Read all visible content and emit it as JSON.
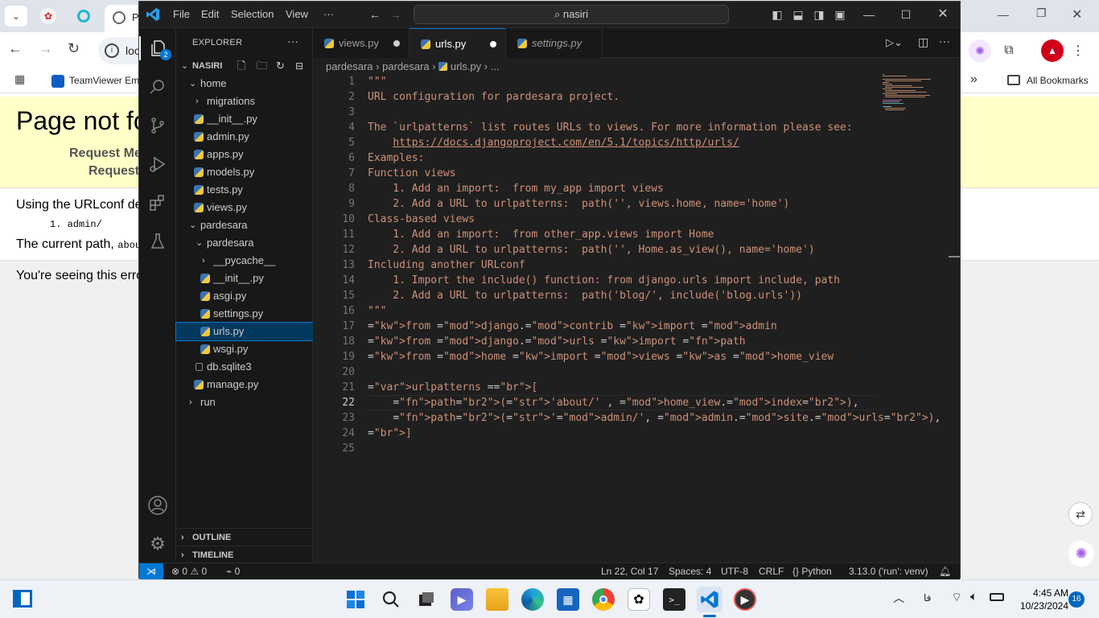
{
  "browser": {
    "address_partial": "loc",
    "bookmark_partial": "TeamViewer Em",
    "all_bookmarks": "All Bookmarks",
    "tab_partial": "P"
  },
  "django_page": {
    "title_partial": "Page not fo",
    "request_method_partial": "Request Me",
    "request_url_partial": "Request",
    "urlconf_partial": "Using the URLconf de",
    "pattern_item": "1. admin/",
    "current_path_partial": "The current path,",
    "current_path_code": "abou",
    "footer_partial": "You're seeing this erro"
  },
  "vscode": {
    "menus": [
      "File",
      "Edit",
      "Selection",
      "View",
      "···"
    ],
    "command_center": "nasiri",
    "explorer_title": "EXPLORER",
    "source_control_badge": "2",
    "root_folder": "NASIRI",
    "tree": [
      {
        "label": "home",
        "indent": 1,
        "chev": "⌄"
      },
      {
        "label": "migrations",
        "indent": 2,
        "chev": "›"
      },
      {
        "label": "__init__.py",
        "indent": 2,
        "py": true
      },
      {
        "label": "admin.py",
        "indent": 2,
        "py": true
      },
      {
        "label": "apps.py",
        "indent": 2,
        "py": true
      },
      {
        "label": "models.py",
        "indent": 2,
        "py": true
      },
      {
        "label": "tests.py",
        "indent": 2,
        "py": true
      },
      {
        "label": "views.py",
        "indent": 2,
        "py": true
      },
      {
        "label": "pardesara",
        "indent": 1,
        "chev": "⌄"
      },
      {
        "label": "pardesara",
        "indent": 2,
        "chev": "⌄"
      },
      {
        "label": "__pycache__",
        "indent": 3,
        "chev": "›"
      },
      {
        "label": "__init__.py",
        "indent": 3,
        "py": true
      },
      {
        "label": "asgi.py",
        "indent": 3,
        "py": true
      },
      {
        "label": "settings.py",
        "indent": 3,
        "py": true
      },
      {
        "label": "urls.py",
        "indent": 3,
        "py": true,
        "selected": true
      },
      {
        "label": "wsgi.py",
        "indent": 3,
        "py": true
      },
      {
        "label": "db.sqlite3",
        "indent": 2,
        "db": true
      },
      {
        "label": "manage.py",
        "indent": 2,
        "py": true
      },
      {
        "label": "run",
        "indent": 1,
        "chev": "›"
      }
    ],
    "outline": "OUTLINE",
    "timeline": "TIMELINE",
    "tabs": [
      {
        "label": "views.py",
        "modified": true,
        "active": false,
        "italic": false
      },
      {
        "label": "urls.py",
        "modified": true,
        "active": true,
        "italic": false
      },
      {
        "label": "settings.py",
        "modified": false,
        "active": false,
        "italic": true
      }
    ],
    "breadcrumb": [
      "pardesara",
      "pardesara",
      "urls.py",
      "..."
    ],
    "current_line": 22,
    "status": {
      "errors": "0",
      "warnings": "0",
      "ports": "0",
      "position": "Ln 22, Col 17",
      "spaces": "Spaces: 4",
      "encoding": "UTF-8",
      "eol": "CRLF",
      "language": "Python",
      "interpreter": "3.13.0 ('run': venv)"
    }
  },
  "code_lines": [
    "\"\"\"",
    "URL configuration for pardesara project.",
    "",
    "The `urlpatterns` list routes URLs to views. For more information please see:",
    "    https://docs.djangoproject.com/en/5.1/topics/http/urls/",
    "Examples:",
    "Function views",
    "    1. Add an import:  from my_app import views",
    "    2. Add a URL to urlpatterns:  path('', views.home, name='home')",
    "Class-based views",
    "    1. Add an import:  from other_app.views import Home",
    "    2. Add a URL to urlpatterns:  path('', Home.as_view(), name='home')",
    "Including another URLconf",
    "    1. Import the include() function: from django.urls import include, path",
    "    2. Add a URL to urlpatterns:  path('blog/', include('blog.urls'))",
    "\"\"\"",
    "from django.contrib import admin",
    "from django.urls import path",
    "from home import views as home_view",
    "",
    "urlpatterns =[",
    "    path('about/' , home_view.index),",
    "    path('admin/', admin.site.urls),",
    "]",
    ""
  ],
  "taskbar": {
    "time": "4:45 AM",
    "date": "10/23/2024",
    "notif_count": "16",
    "lang": "فا"
  }
}
